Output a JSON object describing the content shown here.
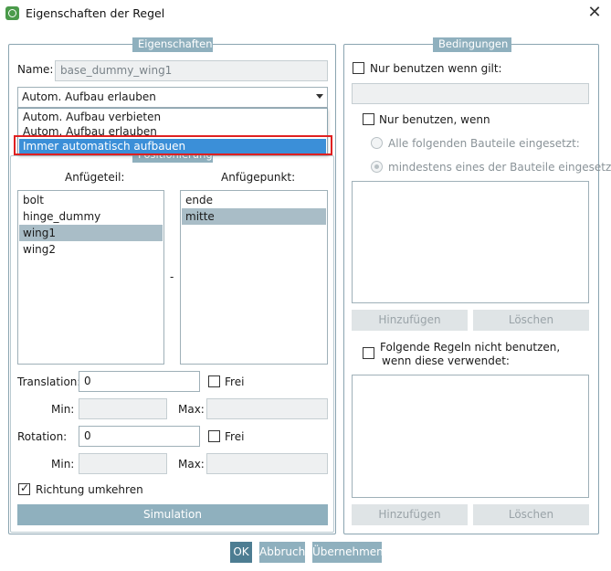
{
  "window": {
    "title": "Eigenschaften der Regel",
    "close": "✕"
  },
  "left": {
    "legend": "Eigenschaften",
    "name_label": "Name:",
    "name_value": "base_dummy_wing1",
    "mode_selected": "Autom. Aufbau erlauben",
    "mode_options": [
      "Autom. Aufbau verbieten",
      "Autom. Aufbau erlauben",
      "Immer automatisch aufbauen"
    ],
    "positioning_legend": "Positionierung",
    "anfuegeteil_label": "Anfügeteil:",
    "anfuegeteil_items": [
      "bolt",
      "hinge_dummy",
      "wing1",
      "wing2"
    ],
    "anfuegeteil_selected": 2,
    "anfuegepunkt_label": "Anfügepunkt:",
    "anfuegepunkt_items": [
      "ende",
      "mitte"
    ],
    "anfuegepunkt_selected": 1,
    "separator": "-",
    "translation_label": "Translation:",
    "translation_value": "0",
    "frei_label": "Frei",
    "min_label": "Min:",
    "max_label": "Max:",
    "rotation_label": "Rotation:",
    "rotation_value": "0",
    "richtung_label": "Richtung umkehren",
    "simulation_label": "Simulation"
  },
  "right": {
    "legend": "Bedingungen",
    "nur_wenn_gilt": "Nur benutzen wenn gilt:",
    "nur_wenn": "Nur benutzen, wenn",
    "radio_alle": "Alle folgenden Bauteile eingesetzt:",
    "radio_mindestens": "mindestens eines der Bauteile eingesetzt:",
    "hinzufuegen": "Hinzufügen",
    "loeschen": "Löschen",
    "folgende_line1": "Folgende Regeln nicht benutzen,",
    "folgende_line2": "wenn diese verwendet:"
  },
  "footer": {
    "ok": "OK",
    "abbruch": "Abbruch",
    "uebernehmen": "Übernehmen"
  }
}
